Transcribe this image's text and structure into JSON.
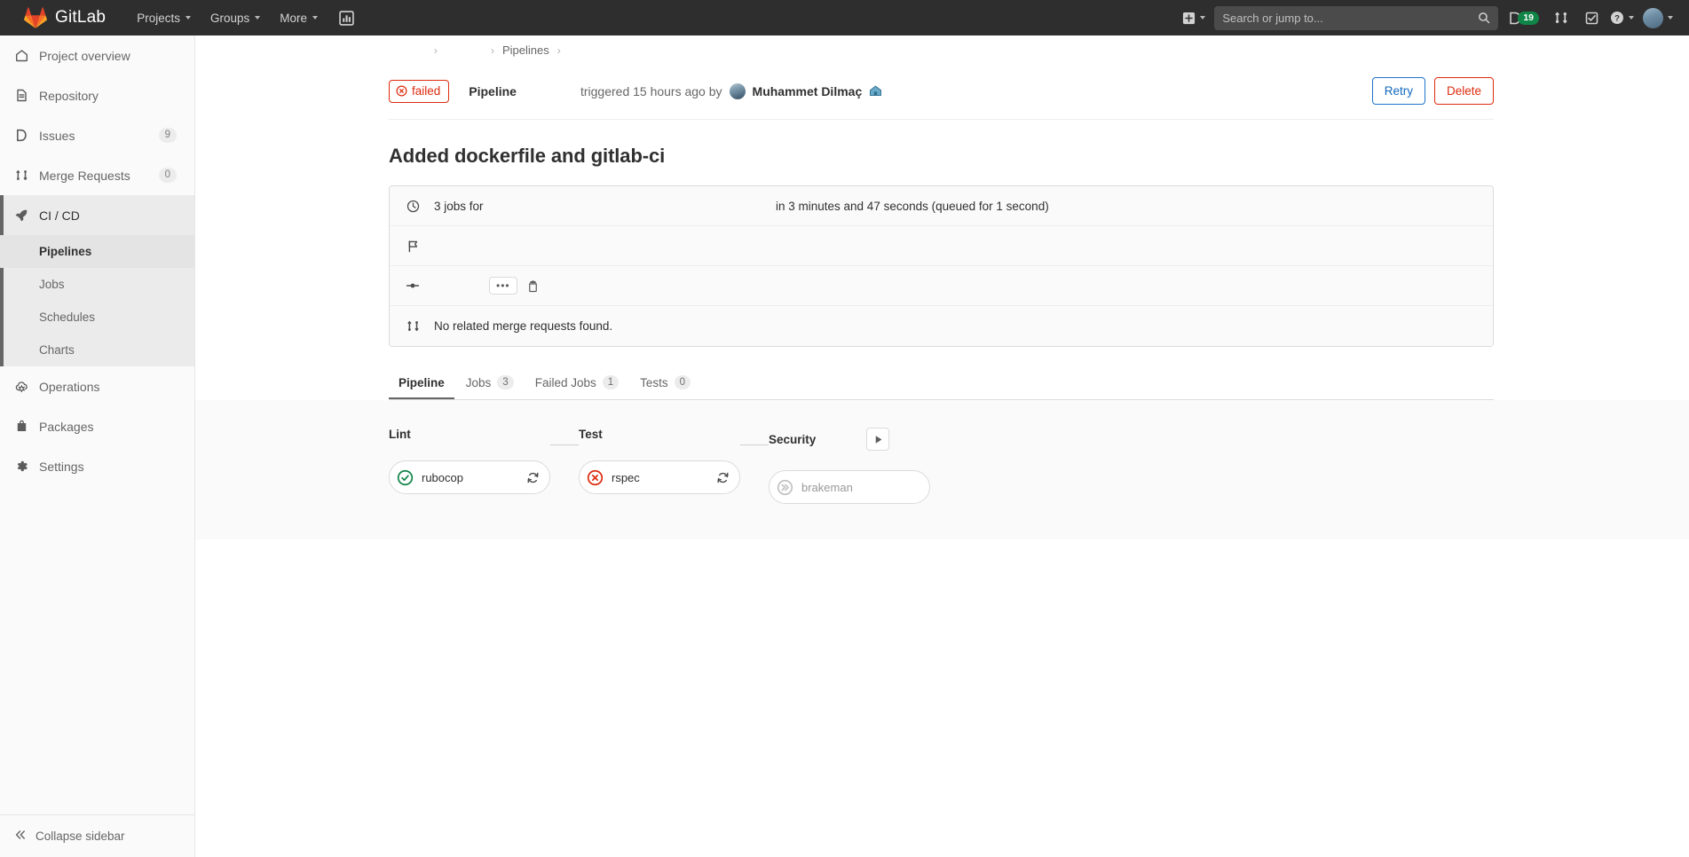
{
  "navbar": {
    "brand": "GitLab",
    "items": [
      {
        "label": "Projects",
        "name": "nav-projects"
      },
      {
        "label": "Groups",
        "name": "nav-groups"
      },
      {
        "label": "More",
        "name": "nav-more"
      }
    ],
    "analytics_icon": "chart-bar-icon",
    "plus_icon": "plus-square-icon",
    "search": {
      "placeholder": "Search or jump to...",
      "value": "",
      "icon": "search-icon"
    },
    "issues_icon": "issues-icon",
    "issues_count": "19",
    "merge_requests_icon": "merge-request-icon",
    "todos_icon": "todo-checkbox-icon",
    "help_icon": "question-circle-icon",
    "avatar_icon": "user-avatar"
  },
  "sidebar": {
    "items": [
      {
        "label": "Project overview",
        "icon": "home-icon",
        "count": ""
      },
      {
        "label": "Repository",
        "icon": "document-icon",
        "count": ""
      },
      {
        "label": "Issues",
        "icon": "issues-icon",
        "count": "9"
      },
      {
        "label": "Merge Requests",
        "icon": "merge-request-icon",
        "count": "0"
      },
      {
        "label": "CI / CD",
        "icon": "rocket-icon",
        "count": ""
      },
      {
        "label": "Operations",
        "icon": "cloud-gear-icon",
        "count": ""
      },
      {
        "label": "Packages",
        "icon": "package-icon",
        "count": ""
      },
      {
        "label": "Settings",
        "icon": "gear-icon",
        "count": ""
      }
    ],
    "cicd_subitems": [
      {
        "label": "Pipelines",
        "active": true
      },
      {
        "label": "Jobs",
        "active": false
      },
      {
        "label": "Schedules",
        "active": false
      },
      {
        "label": "Charts",
        "active": false
      }
    ],
    "collapse_label": "Collapse sidebar",
    "collapse_icon": "chevron-double-left-icon"
  },
  "breadcrumb": {
    "item1": "",
    "item2": "",
    "item3": "Pipelines"
  },
  "pipeline_header": {
    "status_label": "failed",
    "status_icon": "status-failed-icon",
    "status_color": "#dd2b0e",
    "title": "Pipeline",
    "triggered_text": "triggered 15 hours ago by",
    "user_name": "Muhammet Dilmaç",
    "user_badge_icon": "home-badge-icon",
    "retry_label": "Retry",
    "delete_label": "Delete"
  },
  "commit": {
    "title": "Added dockerfile and gitlab-ci"
  },
  "info_rows": [
    {
      "icon": "clock-icon",
      "left_text": "3 jobs for",
      "right_text": "in 3 minutes and 47 seconds (queued for 1 second)"
    },
    {
      "icon": "flag-icon",
      "left_text": "",
      "right_text": ""
    },
    {
      "icon": "commit-icon",
      "left_text": "",
      "right_text": "",
      "ellipsis_label": "•••",
      "copy_icon": "copy-to-clipboard-icon"
    },
    {
      "icon": "merge-request-icon",
      "left_text": "No related merge requests found.",
      "right_text": ""
    }
  ],
  "tabs": [
    {
      "label": "Pipeline",
      "count": "",
      "active": true
    },
    {
      "label": "Jobs",
      "count": "3",
      "active": false
    },
    {
      "label": "Failed Jobs",
      "count": "1",
      "active": false
    },
    {
      "label": "Tests",
      "count": "0",
      "active": false
    }
  ],
  "pipeline_graph": {
    "stages": [
      {
        "name": "Lint",
        "jobs": [
          {
            "name": "rubocop",
            "status": "success",
            "status_icon": "status-success-icon",
            "color": "#108548",
            "retry_icon": "retry-icon",
            "has_retry": true
          }
        ],
        "has_play": false
      },
      {
        "name": "Test",
        "jobs": [
          {
            "name": "rspec",
            "status": "failed",
            "status_icon": "status-failed-icon",
            "color": "#dd2b0e",
            "retry_icon": "retry-icon",
            "has_retry": true
          }
        ],
        "has_play": false
      },
      {
        "name": "Security",
        "jobs": [
          {
            "name": "brakeman",
            "status": "skipped",
            "status_icon": "status-skipped-icon",
            "color": "#bfbfbf",
            "retry_icon": "",
            "has_retry": false
          }
        ],
        "has_play": true,
        "play_icon": "play-icon"
      }
    ]
  }
}
